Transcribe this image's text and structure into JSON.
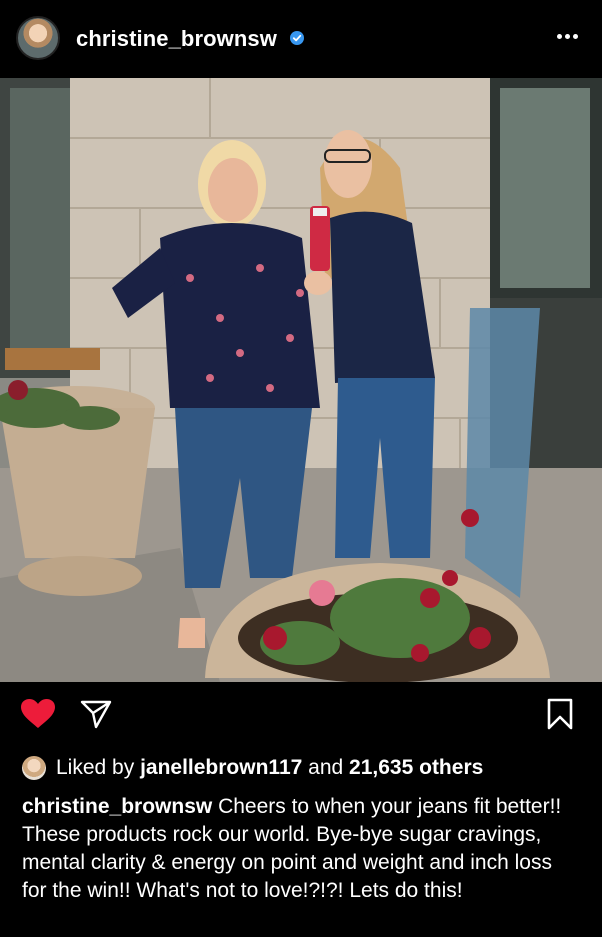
{
  "post": {
    "username": "christine_brownsw",
    "liked_by_prefix": "Liked by",
    "liked_by_user": "janellebrown117",
    "liked_by_and": "and",
    "liked_by_others": "21,635 others",
    "caption_user": "christine_brownsw",
    "caption_text": "Cheers to when your jeans fit better!! These products rock our world. Bye-bye sugar cravings, mental clarity & energy on point and weight and inch loss for the win!! What's not to love!?!?! Lets do this!"
  },
  "icons": {
    "verified": "verified-badge-icon",
    "more": "more-options-icon",
    "like": "heart-icon",
    "share": "send-icon",
    "save": "bookmark-icon"
  },
  "colors": {
    "background": "#000000",
    "like_red": "#ed1c3a",
    "verified_blue": "#3897f0",
    "text": "#ffffff"
  }
}
